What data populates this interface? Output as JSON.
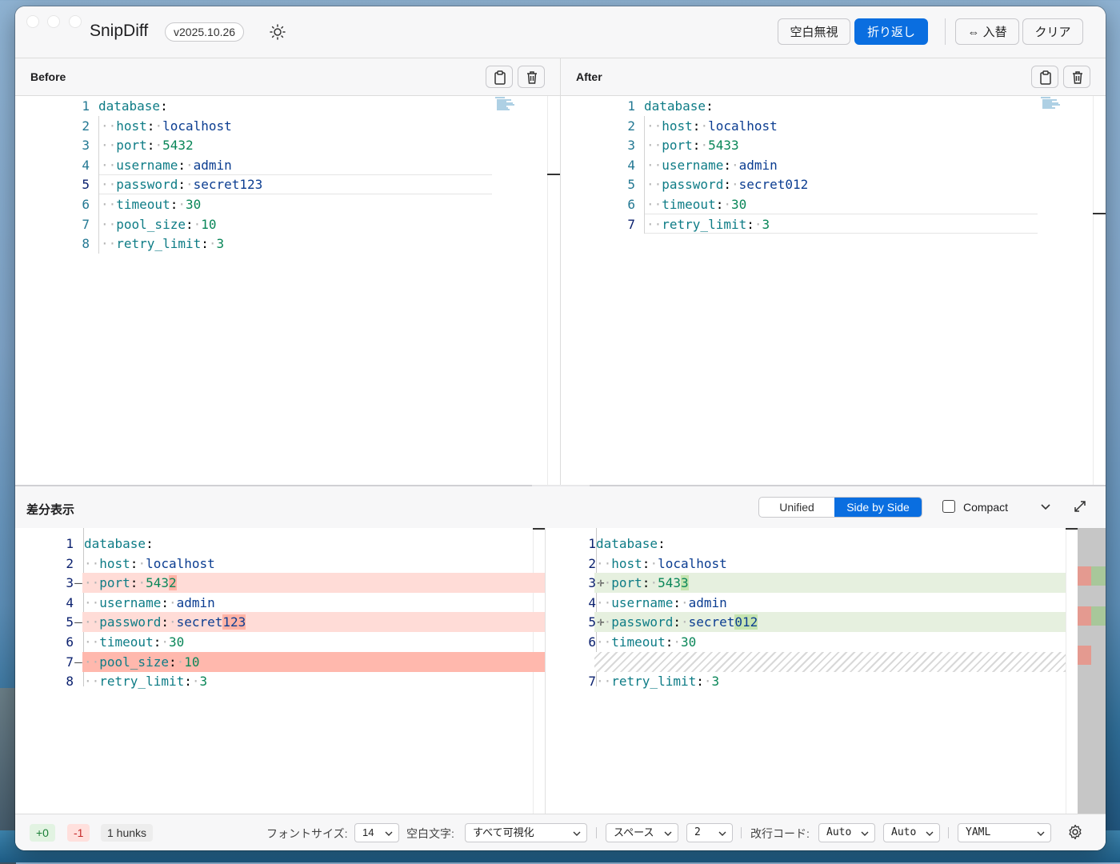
{
  "app": {
    "title": "SnipDiff",
    "version": "v2025.10.26",
    "theme_icon": "sun-icon"
  },
  "toolbar": {
    "ignore_whitespace": "空白無視",
    "wrap": "折り返し",
    "swap": "⇔ 入替",
    "clear": "クリア"
  },
  "before": {
    "label": "Before",
    "lines": [
      {
        "n": "1",
        "key": "database",
        "val": "",
        "indent": false
      },
      {
        "n": "2",
        "key": "host",
        "val": "localhost",
        "indent": true
      },
      {
        "n": "3",
        "key": "port",
        "val": "5432",
        "indent": true
      },
      {
        "n": "4",
        "key": "username",
        "val": "admin",
        "indent": true
      },
      {
        "n": "5",
        "key": "password",
        "val": "secret123",
        "indent": true
      },
      {
        "n": "6",
        "key": "timeout",
        "val": "30",
        "indent": true
      },
      {
        "n": "7",
        "key": "pool_size",
        "val": "10",
        "indent": true
      },
      {
        "n": "8",
        "key": "retry_limit",
        "val": "3",
        "indent": true
      }
    ]
  },
  "after": {
    "label": "After",
    "lines": [
      {
        "n": "1",
        "key": "database",
        "val": "",
        "indent": false
      },
      {
        "n": "2",
        "key": "host",
        "val": "localhost",
        "indent": true
      },
      {
        "n": "3",
        "key": "port",
        "val": "5433",
        "indent": true
      },
      {
        "n": "4",
        "key": "username",
        "val": "admin",
        "indent": true
      },
      {
        "n": "5",
        "key": "password",
        "val": "secret012",
        "indent": true
      },
      {
        "n": "6",
        "key": "timeout",
        "val": "30",
        "indent": true
      },
      {
        "n": "7",
        "key": "retry_limit",
        "val": "3",
        "indent": true
      }
    ]
  },
  "diff": {
    "title": "差分表示",
    "mode_unified": "Unified",
    "mode_side": "Side by Side",
    "compact_label": "Compact",
    "left": [
      {
        "n": "1",
        "sign": "",
        "key": "database",
        "val_a": "",
        "val_b": "",
        "state": "same"
      },
      {
        "n": "2",
        "sign": "",
        "key": "host",
        "val_a": "localhost",
        "val_b": "",
        "state": "same"
      },
      {
        "n": "3",
        "sign": "—",
        "key": "port",
        "val_a": "543",
        "val_b": "2",
        "state": "del"
      },
      {
        "n": "4",
        "sign": "",
        "key": "username",
        "val_a": "admin",
        "val_b": "",
        "state": "same"
      },
      {
        "n": "5",
        "sign": "—",
        "key": "password",
        "val_a": "secret",
        "val_b": "123",
        "state": "del"
      },
      {
        "n": "6",
        "sign": "",
        "key": "timeout",
        "val_a": "30",
        "val_b": "",
        "state": "same"
      },
      {
        "n": "7",
        "sign": "—",
        "key": "pool_size",
        "val_a": "10",
        "val_b": "",
        "state": "delfull"
      },
      {
        "n": "8",
        "sign": "",
        "key": "retry_limit",
        "val_a": "3",
        "val_b": "",
        "state": "same"
      }
    ],
    "right": [
      {
        "n": "1",
        "sign": "",
        "key": "database",
        "val_a": "",
        "val_b": "",
        "state": "same"
      },
      {
        "n": "2",
        "sign": "",
        "key": "host",
        "val_a": "localhost",
        "val_b": "",
        "state": "same"
      },
      {
        "n": "3",
        "sign": "+",
        "key": "port",
        "val_a": "543",
        "val_b": "3",
        "state": "add"
      },
      {
        "n": "4",
        "sign": "",
        "key": "username",
        "val_a": "admin",
        "val_b": "",
        "state": "same"
      },
      {
        "n": "5",
        "sign": "+",
        "key": "password",
        "val_a": "secret",
        "val_b": "012",
        "state": "add"
      },
      {
        "n": "6",
        "sign": "",
        "key": "timeout",
        "val_a": "30",
        "val_b": "",
        "state": "same"
      },
      {
        "n": "",
        "sign": "",
        "key": "",
        "val_a": "",
        "val_b": "",
        "state": "empty"
      },
      {
        "n": "7",
        "sign": "",
        "key": "retry_limit",
        "val_a": "3",
        "val_b": "",
        "state": "same"
      }
    ]
  },
  "status": {
    "added": "+0",
    "removed": "-1",
    "hunks": "1 hunks",
    "font_size_label": "フォントサイズ:",
    "font_size": "14",
    "whitespace_label": "空白文字:",
    "whitespace": "すべて可視化",
    "indent_type": "スペース",
    "indent_size": "2",
    "eol_label": "改行コード:",
    "eol_left": "Auto",
    "eol_right": "Auto",
    "language": "YAML"
  },
  "colors": {
    "accent": "#0a6ee0",
    "deleted": "#ffdcd7",
    "added": "#e6f0df"
  }
}
